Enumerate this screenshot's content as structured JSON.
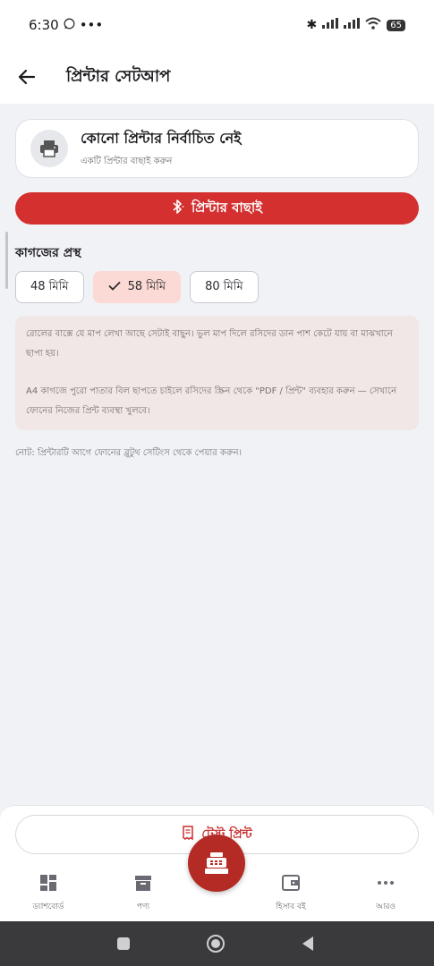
{
  "status": {
    "time": "6:30",
    "battery": "65"
  },
  "app_bar": {
    "title": "প্রিন্টার সেটআপ"
  },
  "printer_card": {
    "title": "কোনো প্রিন্টার নির্বাচিত নেই",
    "subtitle": "একটি প্রিন্টার বাছাই করুন"
  },
  "select_button": {
    "label": "প্রিন্টার বাছাই"
  },
  "paper_size": {
    "title": "কাগজের প্রস্থ",
    "options": [
      "48 মিমি",
      "58 মিমি",
      "80 মিমি"
    ],
    "selected": "58 মিমি"
  },
  "info": {
    "line1": "রোলের বাক্সে যে মাপ লেখা আছে সেটাই বাছুন। ভুল মাপ দিলে রসিদের ডান পাশ কেটে যায় বা মাঝখানে ছাপা হয়।",
    "line2": "A4 কাগজে পুরো পাতার বিল ছাপতে চাইলে রসিদের স্ক্রিন থেকে \"PDF / প্রিন্ট\" ব্যবহার করুন — সেখানে ফোনের নিজের প্রিন্ট ব্যবস্থা খুলবে।"
  },
  "note": "নোট: প্রিন্টারটি আগে ফোনের ব্লুটুথ সেটিংস থেকে পেয়ার করুন।",
  "test_print": {
    "label": "টেস্ট প্রিন্ট"
  },
  "bottom_nav": [
    {
      "label": "ড্যাশবোর্ড",
      "icon": "dashboard-icon"
    },
    {
      "label": "পণ্য",
      "icon": "archive-icon"
    },
    {
      "label": "হিসাব বই",
      "icon": "wallet-icon"
    },
    {
      "label": "আরও",
      "icon": "more-icon"
    }
  ],
  "colors": {
    "accent": "#d3302f",
    "fab": "#b42a24",
    "chip_selected": "#fbd9d4",
    "info_bg": "#f1e7e6"
  }
}
